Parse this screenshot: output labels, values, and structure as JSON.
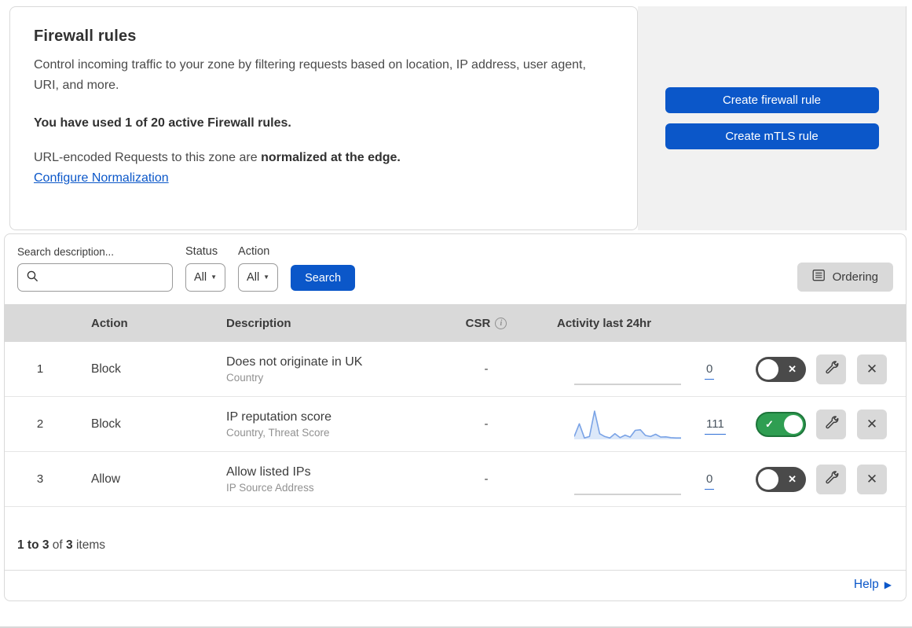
{
  "header": {
    "title": "Firewall rules",
    "description": "Control incoming traffic to your zone by filtering requests based on location, IP address, user agent, URI, and more.",
    "usage": "You have used 1 of 20 active Firewall rules.",
    "normalization_prefix": "URL-encoded Requests to this zone are ",
    "normalization_bold": "normalized at the edge.",
    "normalization_link": "Configure Normalization",
    "create_firewall_label": "Create firewall rule",
    "create_mtls_label": "Create mTLS rule"
  },
  "filters": {
    "search_label": "Search description...",
    "search_value": "",
    "status_label": "Status",
    "status_value": "All",
    "action_label": "Action",
    "action_value": "All",
    "search_button": "Search",
    "ordering_button": "Ordering"
  },
  "table": {
    "columns": {
      "action": "Action",
      "description": "Description",
      "csr": "CSR",
      "activity": "Activity last 24hr"
    },
    "rows": [
      {
        "priority": "1",
        "action": "Block",
        "description": "Does not originate in UK",
        "criteria": "Country",
        "csr": "-",
        "count": "0",
        "enabled": false,
        "sparkline": null
      },
      {
        "priority": "2",
        "action": "Block",
        "description": "IP reputation score",
        "criteria": "Country, Threat Score",
        "csr": "-",
        "count": "111",
        "enabled": true,
        "sparkline": [
          1,
          5.5,
          0.5,
          1,
          10,
          2,
          1,
          0.5,
          2,
          0.6,
          1.5,
          0.8,
          3.2,
          3.4,
          1.4,
          1,
          1.8,
          0.8,
          0.9,
          0.6,
          0.5,
          0.5
        ]
      },
      {
        "priority": "3",
        "action": "Allow",
        "description": "Allow listed IPs",
        "criteria": "IP Source Address",
        "csr": "-",
        "count": "0",
        "enabled": false,
        "sparkline": null
      }
    ]
  },
  "footer": {
    "range_bold": "1 to 3",
    "of_text": "of",
    "total_bold": "3",
    "items_text": "items",
    "help_label": "Help"
  },
  "icons": {
    "caret": "▼",
    "info": "i",
    "toggle_check": "✓",
    "toggle_x": "✕",
    "close": "✕",
    "help_arrow": "▶"
  },
  "colors": {
    "accent_blue": "#0b57c9",
    "panel_gray": "#f1f1f1",
    "header_gray": "#d9d9d9",
    "button_gray": "#d9d9d9",
    "border_gray": "#d9d9d9",
    "row_border": "#e6e6e6",
    "toggle_on_green": "#2f9e52",
    "toggle_on_border": "#1d753a",
    "toggle_off_gray": "#4a4a4a",
    "spark_line": "#7aa3e6",
    "spark_fill": "#dce8f9",
    "flat_line": "#c4c4c4",
    "text_dark": "#313131",
    "text_body": "#4a4a4a",
    "text_muted": "#919191"
  }
}
